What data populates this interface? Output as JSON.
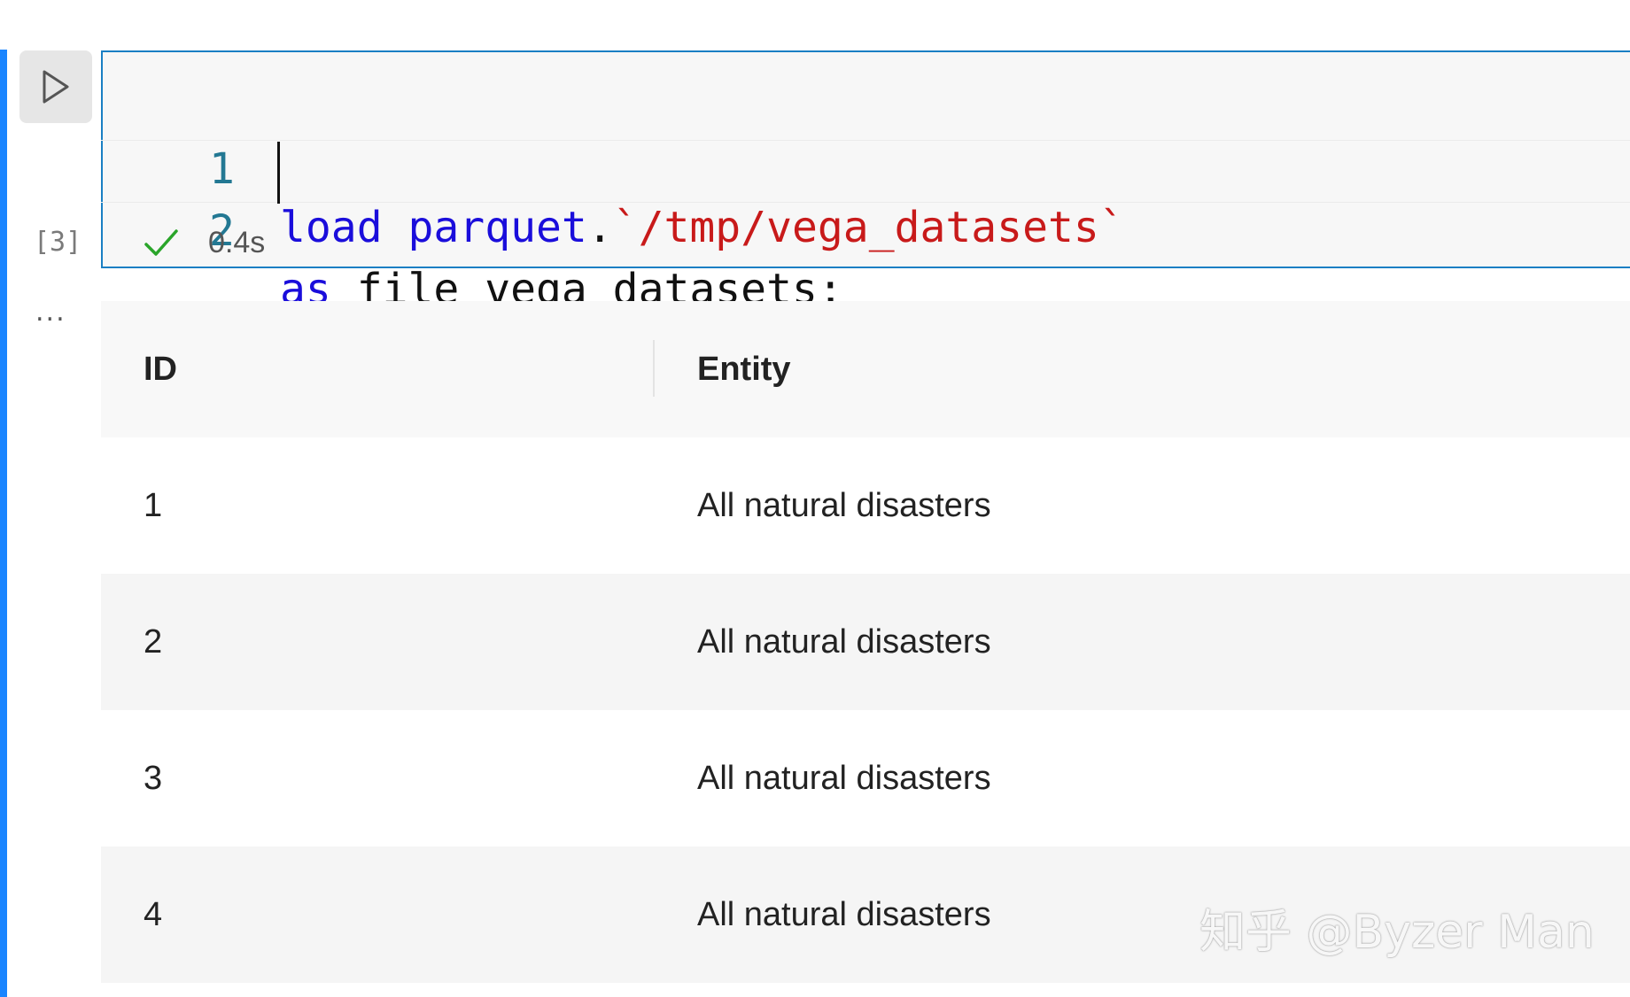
{
  "cell": {
    "run_icon": "play-icon",
    "execution_count": "[3]",
    "more_icon": "ellipsis-icon",
    "more_label": "...",
    "code": {
      "line1": {
        "number": "1",
        "keyword1": "load",
        "keyword2": "parquet",
        "dot": ".",
        "path": "`/tmp/vega_datasets`"
      },
      "line2": {
        "number": "2",
        "keyword": "as",
        "rest": " file_vega_datasets;"
      }
    },
    "status": {
      "icon": "check-icon",
      "duration": "0.4s"
    }
  },
  "table": {
    "columns": [
      "ID",
      "Entity"
    ],
    "rows": [
      [
        "1",
        "All natural disasters"
      ],
      [
        "2",
        "All natural disasters"
      ],
      [
        "3",
        "All natural disasters"
      ],
      [
        "4",
        "All natural disasters"
      ]
    ]
  },
  "watermark": "知乎 @Byzer Man",
  "colors": {
    "focus_bar": "#1a85ff",
    "keyword": "#1a0ddb",
    "string": "#c81a1a",
    "line_number": "#237893",
    "success": "#2aa52a"
  }
}
